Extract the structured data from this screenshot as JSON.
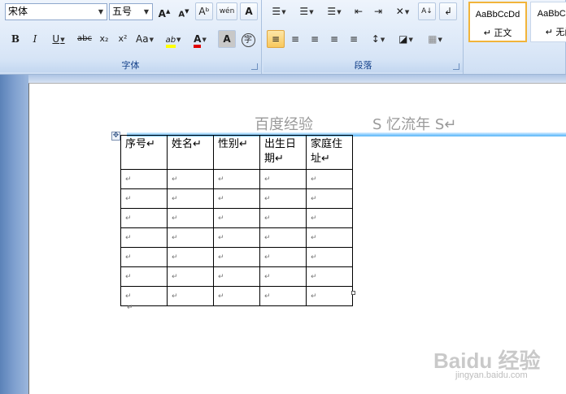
{
  "font_group": {
    "font_name": "宋体",
    "font_size": "五号",
    "grow_label": "A",
    "shrink_label": "A",
    "clear_label": "Aᵇ",
    "phonetic_label": "wén",
    "border_char_label": "A",
    "bold": "B",
    "italic": "I",
    "underline": "U",
    "strike": "abc",
    "subscript": "x₂",
    "superscript": "x²",
    "case": "Aa",
    "highlight": "ab",
    "font_color": "A",
    "char_shade": "A",
    "enclose": "字",
    "label": "字体"
  },
  "paragraph_group": {
    "bullets": "☰",
    "numbering": "☰",
    "multilevel": "☰",
    "decrease_indent": "⇤",
    "increase_indent": "⇥",
    "cn_layout": "✕",
    "sort": "A↓",
    "show_marks": "↲",
    "align_left": "≡",
    "align_center": "≡",
    "align_right": "≡",
    "justify": "≡",
    "distribute": "≡",
    "line_spacing": "↕",
    "shading": "◪",
    "borders": "▦",
    "label": "段落"
  },
  "styles": [
    {
      "sample": "AaBbCcDd",
      "name": "↵ 正文"
    },
    {
      "sample": "AaBbCcDd",
      "name": "↵ 无间"
    }
  ],
  "document": {
    "header_left": "百度经验",
    "header_right": "S 忆流年 S↵",
    "table_header": [
      "序号↵",
      "姓名↵",
      "性别↵",
      "出生日期↵",
      "家庭住址↵"
    ],
    "empty_rows": 7,
    "cell_mark": "↵",
    "end_mark": "↵"
  },
  "watermark": {
    "brand": "Baidu 经验",
    "url": "jingyan.baidu.com"
  },
  "colors": {
    "highlight": "#ffff00",
    "font_color": "#e00000",
    "header_line": "#5ab4f5"
  }
}
